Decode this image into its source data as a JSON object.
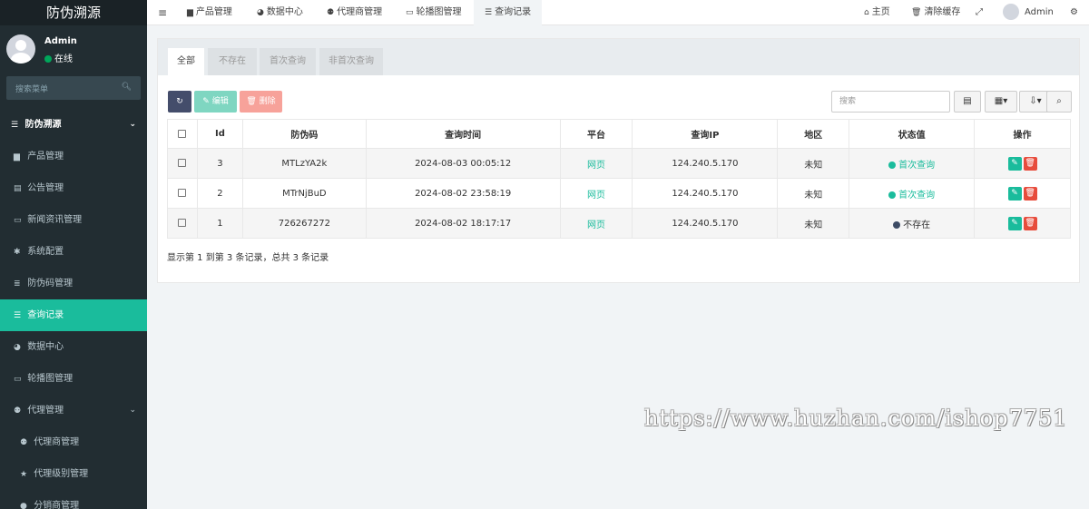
{
  "sidebar": {
    "logo": "防伪溯源",
    "user_name": "Admin",
    "user_status": "在线",
    "search_placeholder": "搜索菜单",
    "menu": [
      {
        "label": "防伪溯源",
        "icon": "list-icon",
        "glyph": "☰"
      },
      {
        "label": "产品管理",
        "icon": "briefcase-icon",
        "glyph": "▆"
      },
      {
        "label": "公告管理",
        "icon": "file-icon",
        "glyph": "▤"
      },
      {
        "label": "新闻资讯管理",
        "icon": "card-icon",
        "glyph": "▭"
      },
      {
        "label": "系统配置",
        "icon": "gear-icon",
        "glyph": "✱"
      },
      {
        "label": "防伪码管理",
        "icon": "doc-icon",
        "glyph": "≣"
      },
      {
        "label": "查询记录",
        "icon": "list-icon",
        "glyph": "☰"
      },
      {
        "label": "数据中心",
        "icon": "dashboard-icon",
        "glyph": "◕"
      },
      {
        "label": "轮播图管理",
        "icon": "card-icon",
        "glyph": "▭"
      },
      {
        "label": "代理管理",
        "icon": "users-icon",
        "glyph": "⚉"
      },
      {
        "label": "代理商管理",
        "icon": "users-icon",
        "glyph": "⚉"
      },
      {
        "label": "代理级别管理",
        "icon": "star-icon",
        "glyph": "★"
      },
      {
        "label": "分销商管理",
        "icon": "user-icon",
        "glyph": "●"
      }
    ]
  },
  "topbar": {
    "menu_toggle": "≡",
    "nav": [
      {
        "label": "产品管理",
        "glyph": "▆"
      },
      {
        "label": "数据中心",
        "glyph": "◕"
      },
      {
        "label": "代理商管理",
        "glyph": "⚉"
      },
      {
        "label": "轮播图管理",
        "glyph": "▭"
      },
      {
        "label": "查询记录",
        "glyph": "☰"
      }
    ],
    "home": "主页",
    "clear_cache": "清除缓存",
    "admin": "Admin"
  },
  "tabs": [
    "全部",
    "不存在",
    "首次查询",
    "非首次查询"
  ],
  "toolbar": {
    "edit_label": "编辑",
    "delete_label": "删除",
    "search_placeholder": "搜索"
  },
  "table": {
    "headers": [
      "Id",
      "防伪码",
      "查询时间",
      "平台",
      "查询IP",
      "地区",
      "状态值",
      "操作"
    ],
    "rows": [
      {
        "id": "3",
        "code": "MTLzYA2k",
        "time": "2024-08-03 00:05:12",
        "platform": "网页",
        "ip": "124.240.5.170",
        "region": "未知",
        "status": "首次查询"
      },
      {
        "id": "2",
        "code": "MTrNjBuD",
        "time": "2024-08-02 23:58:19",
        "platform": "网页",
        "ip": "124.240.5.170",
        "region": "未知",
        "status": "首次查询"
      },
      {
        "id": "1",
        "code": "726267272",
        "time": "2024-08-02 18:17:17",
        "platform": "网页",
        "ip": "124.240.5.170",
        "region": "未知",
        "status": "不存在"
      }
    ]
  },
  "summary": "显示第 1 到第 3 条记录，总共 3 条记录",
  "watermark": "https://www.huzhan.com/ishop7751",
  "colors": {
    "accent": "#1abc9c",
    "sidebar": "#222d32",
    "danger": "#e74c3c"
  }
}
